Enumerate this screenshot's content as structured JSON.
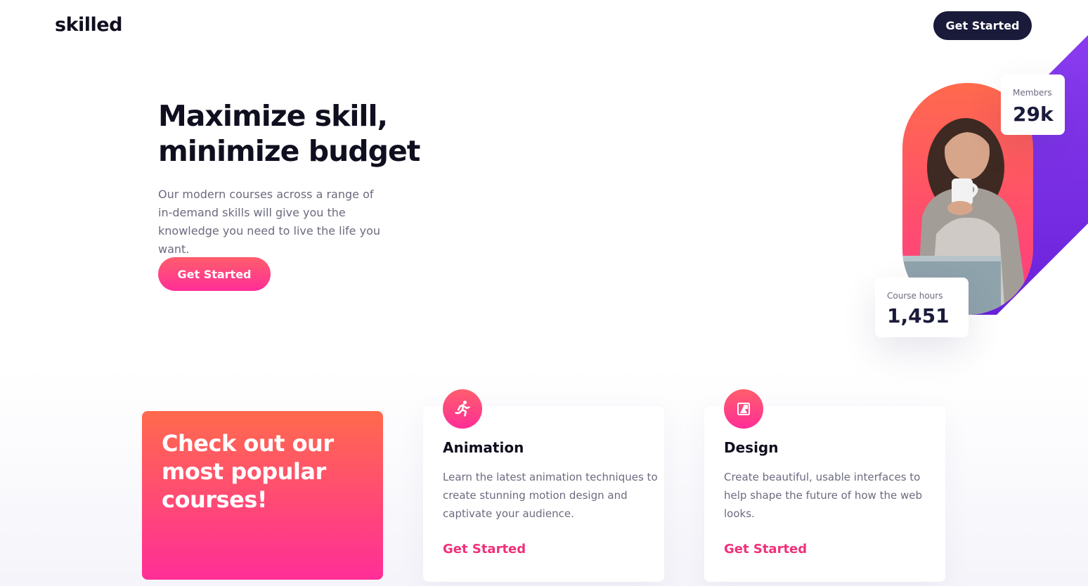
{
  "header": {
    "logo": "skilled",
    "cta_label": "Get Started"
  },
  "hero": {
    "title_line1": "Maximize skill,",
    "title_line2": "minimize budget",
    "description": "Our modern courses across a range of in-demand skills will give you the knowledge you need to live the life you want.",
    "cta_label": "Get Started"
  },
  "stats": {
    "members_label": "Members",
    "members_value": "29k",
    "hours_label": "Course hours",
    "hours_value": "1,451"
  },
  "promo": {
    "title": "Check out our most popular courses!"
  },
  "courses": [
    {
      "icon": "running-person-icon",
      "title": "Animation",
      "description": "Learn the latest animation techniques to create stunning motion design and captivate your audience.",
      "link_label": "Get Started"
    },
    {
      "icon": "design-tool-icon",
      "title": "Design",
      "description": "Create beautiful, usable interfaces to help shape the future of how the web looks.",
      "link_label": "Get Started"
    }
  ],
  "colors": {
    "brand_dark": "#1a1a3a",
    "accent_start": "#ff6a4d",
    "accent_end": "#ff2e97",
    "purple": "#7b2ff2",
    "link": "#f0307a"
  }
}
